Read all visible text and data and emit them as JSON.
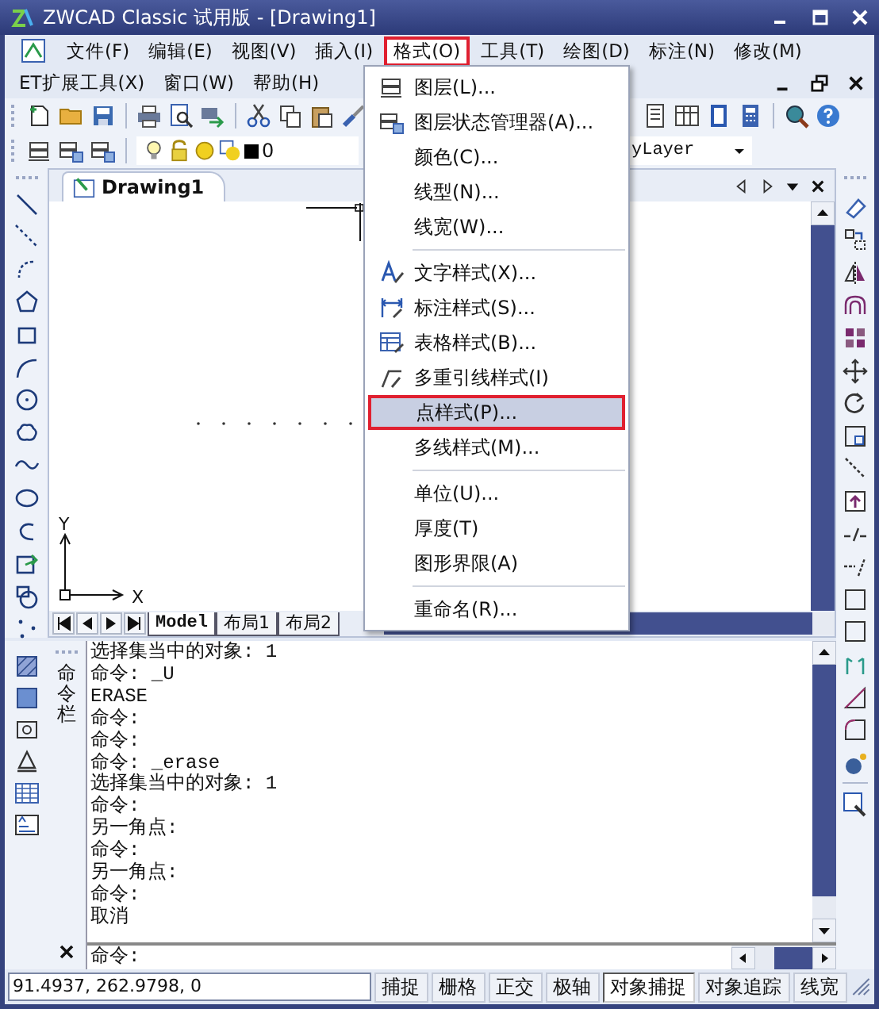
{
  "window": {
    "title": "ZWCAD Classic 试用版 - [Drawing1]"
  },
  "menu_bar": [
    {
      "label": "文件(F)",
      "selected": false
    },
    {
      "label": "编辑(E)",
      "selected": false
    },
    {
      "label": "视图(V)",
      "selected": false
    },
    {
      "label": "插入(I)",
      "selected": false
    },
    {
      "label": "格式(O)",
      "selected": true
    },
    {
      "label": "工具(T)",
      "selected": false
    },
    {
      "label": "绘图(D)",
      "selected": false
    },
    {
      "label": "标注(N)",
      "selected": false
    },
    {
      "label": "修改(M)",
      "selected": false
    }
  ],
  "menu_bar_row2": [
    {
      "label": "ET扩展工具(X)",
      "selected": false
    },
    {
      "label": "窗口(W)",
      "selected": false
    },
    {
      "label": "帮助(H)",
      "selected": false
    }
  ],
  "layer_toolbar": {
    "layer": "0",
    "linetype": "yLayer"
  },
  "document_tab": {
    "label": "Drawing1"
  },
  "ucs": {
    "x": "X",
    "y": "Y"
  },
  "layout_tabs": [
    {
      "label": "Model",
      "selected": true
    },
    {
      "label": "布局1",
      "selected": false
    },
    {
      "label": "布局2",
      "selected": false
    }
  ],
  "format_menu": [
    [
      {
        "label": "图层(L)...",
        "selected": false
      },
      {
        "label": "图层状态管理器(A)...",
        "selected": false
      },
      {
        "label": "颜色(C)...",
        "selected": false
      },
      {
        "label": "线型(N)...",
        "selected": false
      },
      {
        "label": "线宽(W)...",
        "selected": false
      }
    ],
    [
      {
        "label": "文字样式(X)...",
        "selected": false
      },
      {
        "label": "标注样式(S)...",
        "selected": false
      },
      {
        "label": "表格样式(B)...",
        "selected": false
      },
      {
        "label": "多重引线样式(I)",
        "selected": false
      },
      {
        "label": "点样式(P)...",
        "selected": true
      },
      {
        "label": "多线样式(M)...",
        "selected": false
      }
    ],
    [
      {
        "label": "单位(U)...",
        "selected": false
      },
      {
        "label": "厚度(T)",
        "selected": false
      },
      {
        "label": "图形界限(A)",
        "selected": false
      }
    ],
    [
      {
        "label": "重命名(R)...",
        "selected": false
      }
    ]
  ],
  "command_panel": {
    "title": "命令栏",
    "history": [
      "选择集当中的对象: 1",
      "命令: _U",
      "ERASE",
      "命令:",
      "命令:",
      "命令: _erase",
      "选择集当中的对象: 1",
      "命令:",
      "另一角点:",
      "命令:",
      "另一角点:",
      "命令:",
      "取消"
    ],
    "prompt": "命令:"
  },
  "status_bar": {
    "coordinates": "91.4937, 262.9798, 0",
    "toggles": [
      {
        "label": "捕捉",
        "on": false
      },
      {
        "label": "栅格",
        "on": false
      },
      {
        "label": "正交",
        "on": false
      },
      {
        "label": "极轴",
        "on": false
      },
      {
        "label": "对象捕捉",
        "on": true
      },
      {
        "label": "对象追踪",
        "on": false
      },
      {
        "label": "线宽",
        "on": false
      }
    ]
  }
}
